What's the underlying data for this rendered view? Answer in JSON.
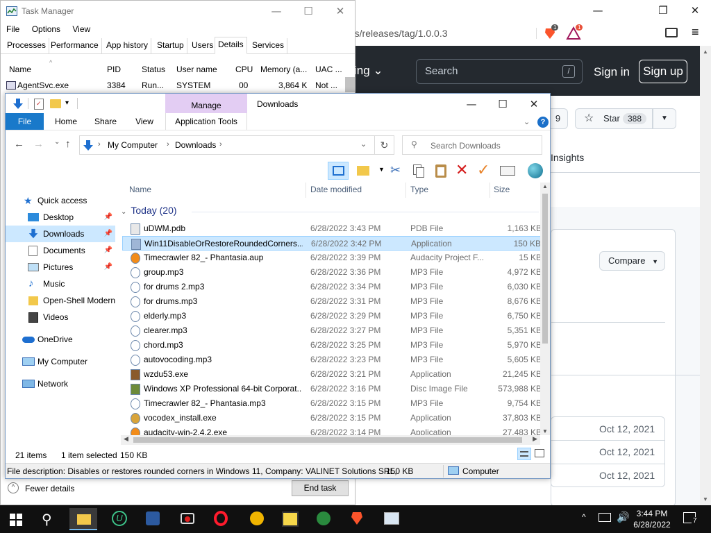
{
  "browser": {
    "url_fragment": "rs/releases/tag/1.0.0.3",
    "brave_badge": "1",
    "bat_badge": "1",
    "nav_partial": "ing",
    "search_placeholder": "Search",
    "search_shortcut": "/",
    "sign_in": "Sign in",
    "sign_up": "Sign up",
    "watch_count_partial": "9",
    "star_label": "Star",
    "star_count": "388",
    "insights_tab": "Insights",
    "compare_label": "Compare",
    "dates": [
      "Oct 12, 2021",
      "Oct 12, 2021",
      "Oct 12, 2021"
    ]
  },
  "taskmgr": {
    "title": "Task Manager",
    "menu": [
      "File",
      "Options",
      "View"
    ],
    "tabs": [
      "Processes",
      "Performance",
      "App history",
      "Startup",
      "Users",
      "Details",
      "Services"
    ],
    "active_tab": "Details",
    "columns": [
      "Name",
      "PID",
      "Status",
      "User name",
      "CPU",
      "Memory (a...",
      "UAC ..."
    ],
    "row": {
      "name": "AgentSvc.exe",
      "pid": "3384",
      "status": "Run...",
      "user": "SYSTEM",
      "cpu": "00",
      "memory": "3,864 K",
      "uac": "Not ..."
    },
    "fewer_details": "Fewer details",
    "end_task": "End task"
  },
  "explorer": {
    "title": "Downloads",
    "manage_tab": "Manage",
    "ribbon_tabs": [
      "File",
      "Home",
      "Share",
      "View",
      "Application Tools"
    ],
    "breadcrumb": [
      "My Computer",
      "Downloads"
    ],
    "search_placeholder": "Search Downloads",
    "columns": {
      "name": "Name",
      "date": "Date modified",
      "type": "Type",
      "size": "Size"
    },
    "group_label": "Today (20)",
    "nav": {
      "quick_access": "Quick access",
      "desktop": "Desktop",
      "downloads": "Downloads",
      "documents": "Documents",
      "pictures": "Pictures",
      "music": "Music",
      "openshell": "Open-Shell Modern",
      "videos": "Videos",
      "onedrive": "OneDrive",
      "mycomputer": "My Computer",
      "network": "Network"
    },
    "files": [
      {
        "name": "uDWM.pdb",
        "date": "6/28/2022 3:43 PM",
        "type": "PDB File",
        "size": "1,163 KB",
        "icon": "generic-file-icon"
      },
      {
        "name": "Win11DisableOrRestoreRoundedCorners....",
        "date": "6/28/2022 3:42 PM",
        "type": "Application",
        "size": "150 KB",
        "icon": "application-icon"
      },
      {
        "name": "Timecrawler 82_- Phantasia.aup",
        "date": "6/28/2022 3:39 PM",
        "type": "Audacity Project F...",
        "size": "15 KB",
        "icon": "audacity-icon"
      },
      {
        "name": "group.mp3",
        "date": "6/28/2022 3:36 PM",
        "type": "MP3 File",
        "size": "4,972 KB",
        "icon": "mp3-icon"
      },
      {
        "name": "for drums 2.mp3",
        "date": "6/28/2022 3:34 PM",
        "type": "MP3 File",
        "size": "6,030 KB",
        "icon": "mp3-icon"
      },
      {
        "name": "for drums.mp3",
        "date": "6/28/2022 3:31 PM",
        "type": "MP3 File",
        "size": "8,676 KB",
        "icon": "mp3-icon"
      },
      {
        "name": "elderly.mp3",
        "date": "6/28/2022 3:29 PM",
        "type": "MP3 File",
        "size": "6,750 KB",
        "icon": "mp3-icon"
      },
      {
        "name": "clearer.mp3",
        "date": "6/28/2022 3:27 PM",
        "type": "MP3 File",
        "size": "5,351 KB",
        "icon": "mp3-icon"
      },
      {
        "name": "chord.mp3",
        "date": "6/28/2022 3:25 PM",
        "type": "MP3 File",
        "size": "5,970 KB",
        "icon": "mp3-icon"
      },
      {
        "name": "autovocoding.mp3",
        "date": "6/28/2022 3:23 PM",
        "type": "MP3 File",
        "size": "5,605 KB",
        "icon": "mp3-icon"
      },
      {
        "name": "wzdu53.exe",
        "date": "6/28/2022 3:21 PM",
        "type": "Application",
        "size": "21,245 KB",
        "icon": "installer-icon"
      },
      {
        "name": "Windows XP Professional 64-bit Corporat...",
        "date": "6/28/2022 3:16 PM",
        "type": "Disc Image File",
        "size": "573,988 KB",
        "icon": "disc-image-icon"
      },
      {
        "name": "Timecrawler 82_- Phantasia.mp3",
        "date": "6/28/2022 3:15 PM",
        "type": "MP3 File",
        "size": "9,754 KB",
        "icon": "mp3-icon"
      },
      {
        "name": "vocodex_install.exe",
        "date": "6/28/2022 3:15 PM",
        "type": "Application",
        "size": "37,803 KB",
        "icon": "vocodex-icon"
      },
      {
        "name": "audacity-win-2.4.2.exe",
        "date": "6/28/2022 3:14 PM",
        "type": "Application",
        "size": "27,483 KB",
        "icon": "audacity-icon"
      }
    ],
    "selected_index": 1,
    "status_items": "21 items",
    "status_selected": "1 item selected",
    "status_size": "150 KB",
    "description": "File description: Disables or restores rounded corners in Windows 11, Company: VALINET Solutions SRL,",
    "desc_size": "150 KB",
    "desc_location": "Computer"
  },
  "taskbar": {
    "time": "3:44 PM",
    "date": "6/28/2022",
    "notification_count": "7"
  },
  "colors": {
    "accent": "#0078d7",
    "selection": "#cce8ff",
    "github_dark": "#24292f",
    "file_tab": "#1979ca",
    "manage_tab": "#e0c8f0"
  }
}
